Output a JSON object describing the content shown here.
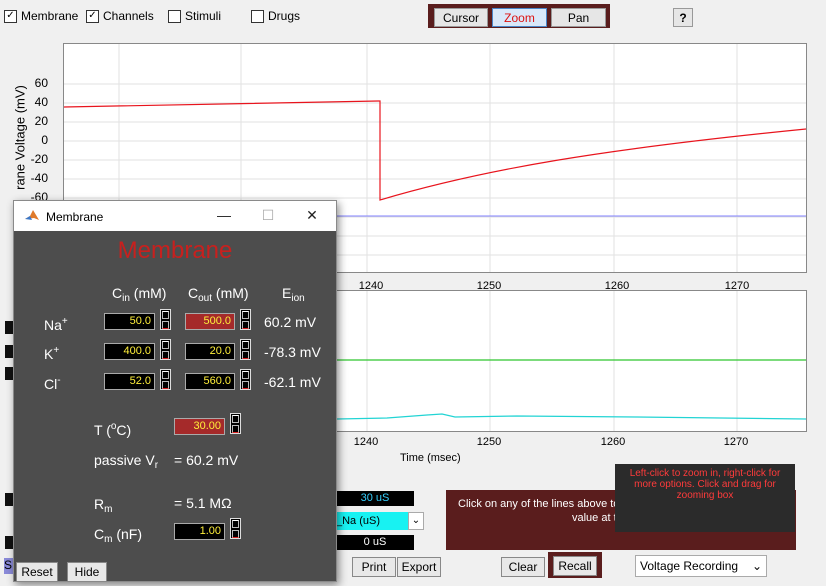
{
  "checkboxes": [
    {
      "label": "Membrane",
      "checked": true
    },
    {
      "label": "Channels",
      "checked": true
    },
    {
      "label": "Stimuli",
      "checked": false
    },
    {
      "label": "Drugs",
      "checked": false
    }
  ],
  "toolbar": {
    "cursor": "Cursor",
    "zoom": "Zoom",
    "pan": "Pan",
    "help": "?"
  },
  "top_plot": {
    "ylabel": "rane Voltage (mV)",
    "yticks": [
      "60",
      "40",
      "20",
      "0",
      "-20",
      "-40",
      "-60"
    ],
    "xticks": [
      "1240",
      "1250",
      "1260",
      "1270"
    ]
  },
  "bottom_plot": {
    "xticks": [
      "1240",
      "1250",
      "1260",
      "1270"
    ],
    "xlabel": "Time (msec)"
  },
  "controls": {
    "value_top": "30 uS",
    "channel_select": "_Na (uS)",
    "value_bottom": "0 uS",
    "print": "Print",
    "export": "Export",
    "clear": "Clear",
    "recall": "Recall",
    "s_button": "S",
    "recording_select": "Voltage Recording",
    "info_text": "Click on any of the lines above to",
    "info_text2": "value at t",
    "tooltip": "Left-click to zoom in, right-click for more options. Click and drag for zooming box"
  },
  "dialog": {
    "window_title": "Membrane",
    "heading": "Membrane",
    "col_cin": "C",
    "col_cin_sub": "in",
    "col_cin_unit": " (mM)",
    "col_cout": "C",
    "col_cout_sub": "out",
    "col_cout_unit": " (mM)",
    "col_eion": "E",
    "col_eion_sub": "ion",
    "ions": [
      {
        "name": "Na",
        "charge": "+",
        "cin": "50.0",
        "cout": "500.0",
        "eion": "60.2 mV"
      },
      {
        "name": "K",
        "charge": "+",
        "cin": "400.0",
        "cout": "20.0",
        "eion": "-78.3 mV"
      },
      {
        "name": "Cl",
        "charge": "-",
        "cin": "52.0",
        "cout": "560.0",
        "eion": "-62.1 mV"
      }
    ],
    "temp_label": "T (",
    "temp_sup": "o",
    "temp_unit": "C)",
    "temp_value": "30.00",
    "passive_label": "passive V",
    "passive_sub": "r",
    "passive_value": "=  60.2 mV",
    "rm_label": "R",
    "rm_sub": "m",
    "rm_value": "=   5.1 MΩ",
    "cm_label": "C",
    "cm_sub": "m",
    "cm_unit": " (nF)",
    "cm_value": "1.00",
    "reset": "Reset",
    "hide": "Hide"
  },
  "colors": {
    "voltage_trace": "#e8141d",
    "dialog_bg": "#4d4d4d",
    "heading": "#c8201e",
    "field_text": "#ffef3a",
    "green_trace": "#2ec52e",
    "cyan_trace": "#22d4d4"
  }
}
